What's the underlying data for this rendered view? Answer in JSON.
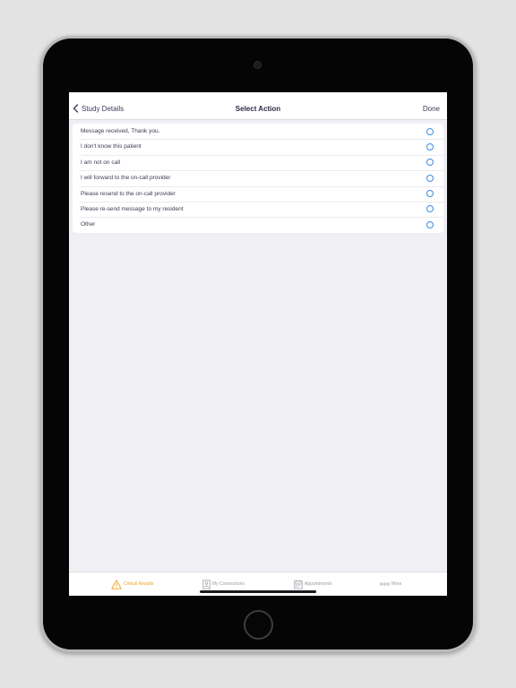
{
  "navbar": {
    "back_label": "Study Details",
    "title": "Select Action",
    "done_label": "Done"
  },
  "options": [
    "Message received, Thank you.",
    "I don't know this patient",
    "I am not on call",
    "I will forward to the on-call provider",
    "Please resend to the on-call provider",
    "Please re-send message to my resident",
    "Other"
  ],
  "tabs": [
    {
      "label": "Critical Results",
      "icon": "warning-icon",
      "active": true
    },
    {
      "label": "My Connections",
      "icon": "connections-icon",
      "active": false
    },
    {
      "label": "Appointments",
      "icon": "calendar-icon",
      "active": false
    },
    {
      "label": "More",
      "icon": "more-dots-icon",
      "active": false
    }
  ],
  "colors": {
    "accent_radio": "#3a8ee6",
    "active_tab": "#f0a018",
    "inactive_tab": "#9a9aa8"
  }
}
